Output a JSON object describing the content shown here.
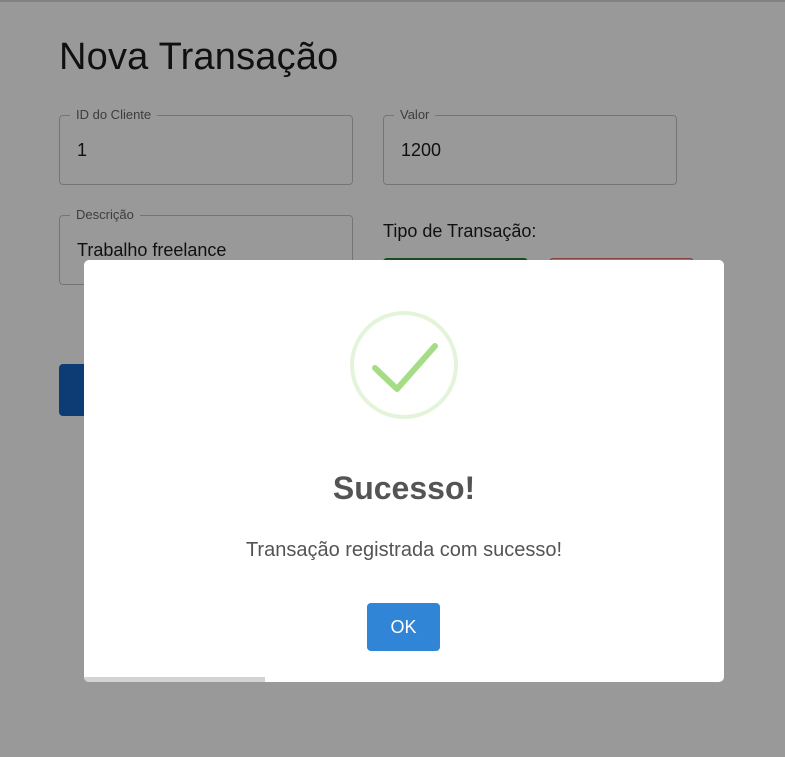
{
  "form": {
    "title": "Nova Transação",
    "client_id": {
      "label": "ID do Cliente",
      "value": "1"
    },
    "amount": {
      "label": "Valor",
      "value": "1200"
    },
    "description": {
      "label": "Descrição",
      "value": "Trabalho freelance"
    },
    "transaction_type_label": "Tipo de Transação:"
  },
  "dialog": {
    "icon": "checkmark-icon",
    "title": "Sucesso!",
    "message": "Transação registrada com sucesso!",
    "confirm_label": "OK",
    "timer_progress": 0.283
  },
  "colors": {
    "credit_button": "#2e7d32",
    "debit_button": "#f5c6c6",
    "submit_button": "#1565c0",
    "ok_button": "#3085d6",
    "success_green": "#a5dc86"
  }
}
